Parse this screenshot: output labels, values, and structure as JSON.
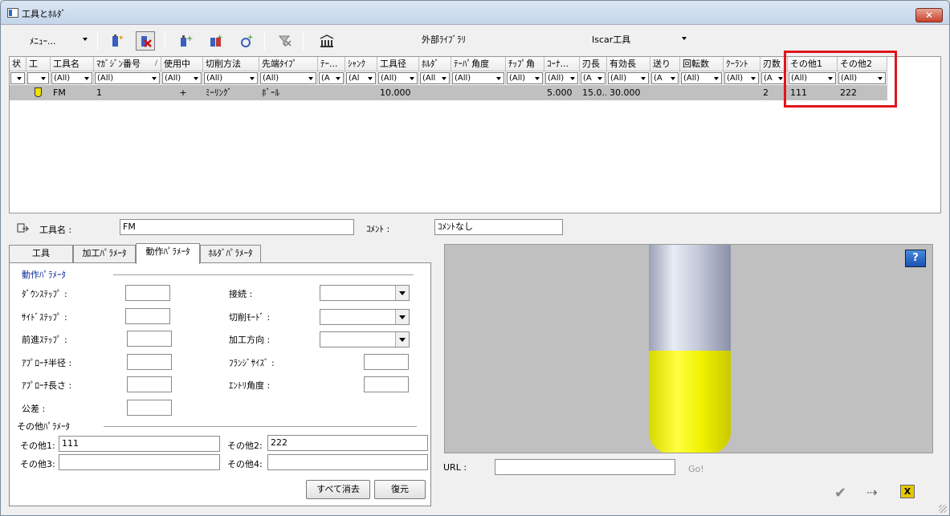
{
  "window": {
    "title": "工具とﾎﾙﾀﾞ",
    "close_label": "✕"
  },
  "toolbar": {
    "menu_label": "ﾒﾆｭｰ...",
    "external_library": "外部ﾗｲﾌﾞﾗﾘ",
    "library_select": "Iscar工具"
  },
  "grid": {
    "columns": [
      "状",
      "工",
      "工具名",
      "ﾏｶﾞｼﾞﾝ番号",
      "使用中",
      "切削方法",
      "先端ﾀｲﾌﾟ",
      "ﾃｰ...",
      "ｼｬﾝｸ",
      "工具径",
      "ﾎﾙﾀﾞ",
      "ﾃｰﾊﾟ角度",
      "ﾁｯﾌﾟ角",
      "ｺｰﾅ...",
      "刃長",
      "有効長",
      "送り",
      "回転数",
      "ｸｰﾗﾝﾄ",
      "刃数",
      "その他1",
      "その他2"
    ],
    "sort_indicator": "/",
    "filters": [
      "",
      "",
      "(All)",
      "(All)",
      "(All)",
      "(All)",
      "(All)",
      "(A",
      "(Al",
      "(All)",
      "(All",
      "(All)",
      "(All)",
      "(All)",
      "(A",
      "(All)",
      "(A",
      "(All)",
      "(All)",
      "(A",
      "(All)",
      "(All)"
    ],
    "rows": [
      [
        "",
        "",
        "FM",
        "1",
        "+",
        "ﾐｰﾘﾝｸﾞ",
        "ﾎﾞｰﾙ",
        "",
        "",
        "10.000",
        "",
        "",
        "",
        "5.000",
        "15.0...",
        "30.000",
        "",
        "",
        "",
        "2",
        "111",
        "222"
      ]
    ]
  },
  "details": {
    "tool_name_label": "工具名 :",
    "tool_name_value": "FM",
    "comment_label": "ｺﾒﾝﾄ :",
    "comment_value": "ｺﾒﾝﾄなし"
  },
  "tabs": [
    "工具",
    "加工ﾊﾟﾗﾒｰﾀ",
    "動作ﾊﾟﾗﾒｰﾀ",
    "ﾎﾙﾀﾞﾊﾟﾗﾒｰﾀ"
  ],
  "motion": {
    "group_label": "動作ﾊﾟﾗﾒｰﾀ",
    "down_step": "ﾀﾞｳﾝｽﾃｯﾌﾟ :",
    "side_step": "ｻｲﾄﾞｽﾃｯﾌﾟ :",
    "forward_step": "前進ｽﾃｯﾌﾟ :",
    "approach_radius": "ｱﾌﾟﾛｰﾁ半径 :",
    "approach_length": "ｱﾌﾟﾛｰﾁ長さ :",
    "tolerance": "公差 :",
    "connection": "接続 :",
    "cut_mode": "切削ﾓｰﾄﾞ :",
    "direction": "加工方向 :",
    "flange_size": "ﾌﾗﾝｼﾞｻｲｽﾞ :",
    "entry_angle": "ｴﾝﾄﾘ角度 :"
  },
  "other": {
    "group_label": "その他ﾊﾟﾗﾒｰﾀ",
    "o1_label": "その他1:",
    "o1_value": "111",
    "o2_label": "その他2:",
    "o2_value": "222",
    "o3_label": "その他3:",
    "o3_value": "",
    "o4_label": "その他4:",
    "o4_value": ""
  },
  "buttons": {
    "clear_all": "すべて消去",
    "restore": "復元"
  },
  "url": {
    "label": "URL :",
    "value": "",
    "go": "Go!"
  },
  "help_label": "?",
  "exit_label": "X",
  "colors": {
    "highlight": "#e0141b",
    "selected_row": "#c0c0c0",
    "flute": "#ffff00"
  }
}
